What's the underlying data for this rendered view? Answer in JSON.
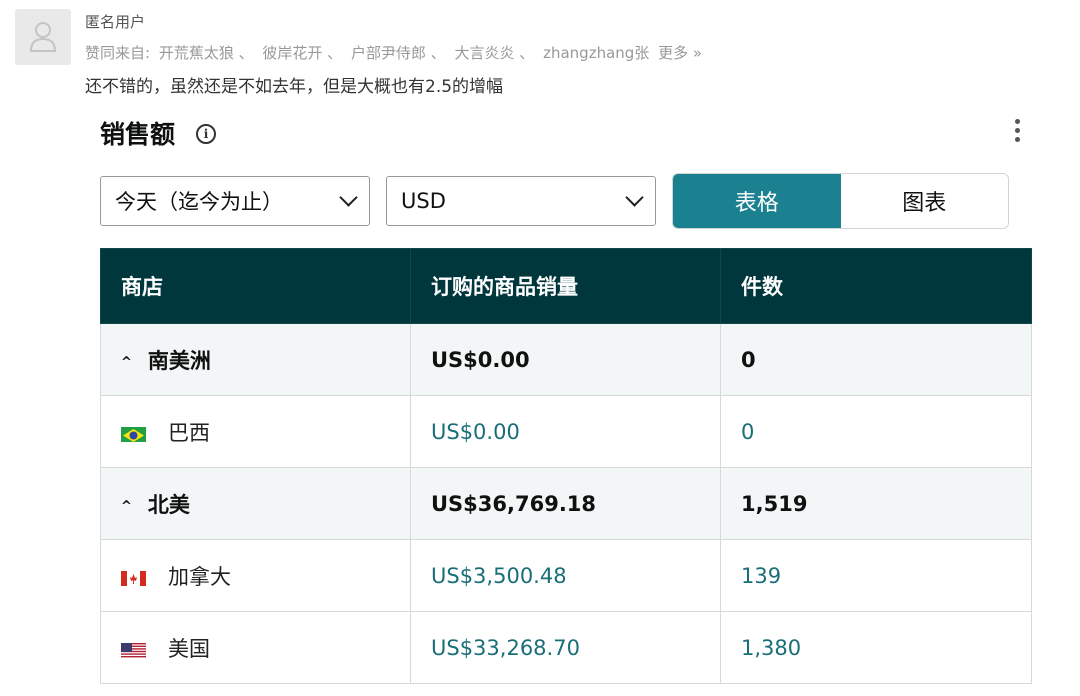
{
  "comment": {
    "username": "匿名用户",
    "likes_prefix": "赞同来自:",
    "likers": [
      "开荒蕉太狼 、",
      "彼岸花开 、",
      "户部尹侍郎 、",
      "大言炎炎 、",
      "zhangzhang张"
    ],
    "more": "更多 »",
    "text": "还不错的，虽然还是不如去年，但是大概也有2.5的增幅"
  },
  "widget": {
    "title": "销售额",
    "info_icon": "info-icon",
    "menu_icon": "kebab-menu-icon",
    "range_select": "今天（迄今为止）",
    "currency_select": "USD",
    "view_toggle": {
      "table": "表格",
      "chart": "图表",
      "selected": "表格"
    },
    "accent_color": "#1b8190",
    "header_color": "#00373d"
  },
  "table": {
    "headers": [
      "商店",
      "订购的商品销量",
      "件数"
    ],
    "rows": [
      {
        "type": "region",
        "name": "南美洲",
        "sales": "US$0.00",
        "units": "0"
      },
      {
        "type": "country",
        "flag": "brazil-flag-icon",
        "name": "巴西",
        "sales": "US$0.00",
        "units": "0"
      },
      {
        "type": "region",
        "name": "北美",
        "sales": "US$36,769.18",
        "units": "1,519"
      },
      {
        "type": "country",
        "flag": "canada-flag-icon",
        "name": "加拿大",
        "sales": "US$3,500.48",
        "units": "139"
      },
      {
        "type": "country",
        "flag": "usa-flag-icon",
        "name": "美国",
        "sales": "US$33,268.70",
        "units": "1,380"
      }
    ]
  }
}
